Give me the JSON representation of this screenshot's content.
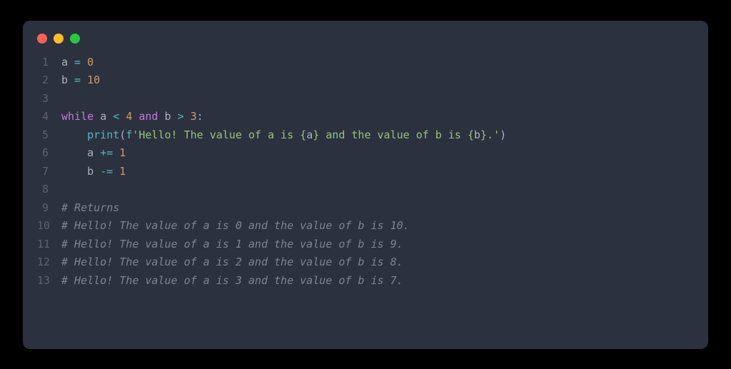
{
  "window": {
    "dots": [
      "red",
      "yellow",
      "green"
    ]
  },
  "code": {
    "line1": {
      "a": "a",
      "eq": " = ",
      "v": "0"
    },
    "line2": {
      "b": "b",
      "eq": " = ",
      "v": "10"
    },
    "line4": {
      "kw1": "while",
      "sp1": " ",
      "a": "a",
      "sp2": " ",
      "lt": "<",
      "sp3": " ",
      "n4": "4",
      "sp4": " ",
      "and": "and",
      "sp5": " ",
      "b": "b",
      "sp6": " ",
      "gt": ">",
      "sp7": " ",
      "n3": "3",
      "colon": ":"
    },
    "line5": {
      "indent": "    ",
      "fn": "print",
      "lp": "(",
      "pfx": "f",
      "s1": "'Hello! The value of a is {",
      "ia": "a",
      "s2": "} and the value of b is {",
      "ib": "b",
      "s3": "}.'",
      "rp": ")"
    },
    "line6": {
      "indent": "    ",
      "a": "a",
      "sp": " ",
      "op": "+=",
      "sp2": " ",
      "v": "1"
    },
    "line7": {
      "indent": "    ",
      "b": "b",
      "sp": " ",
      "op": "-=",
      "sp2": " ",
      "v": "1"
    },
    "line9": "# Returns",
    "line10": "# Hello! The value of a is 0 and the value of b is 10.",
    "line11": "# Hello! The value of a is 1 and the value of b is 9.",
    "line12": "# Hello! The value of a is 2 and the value of b is 8.",
    "line13": "# Hello! The value of a is 3 and the value of b is 7."
  },
  "gutter": {
    "l1": "1",
    "l2": "2",
    "l3": "3",
    "l4": "4",
    "l5": "5",
    "l6": "6",
    "l7": "7",
    "l8": "8",
    "l9": "9",
    "l10": "10",
    "l11": "11",
    "l12": "12",
    "l13": "13"
  }
}
